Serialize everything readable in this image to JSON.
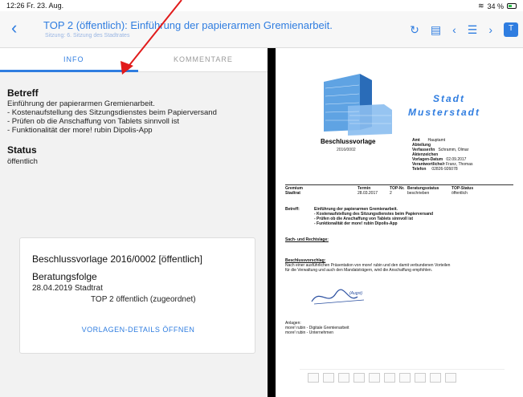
{
  "status_bar": {
    "time": "12:26",
    "date": "Fr. 23. Aug.",
    "battery": "34 %"
  },
  "navbar": {
    "title": "TOP 2 (öffentlich): Einführung der papierarmen Gremienarbeit.",
    "subtitle": "Sitzung: 6. Sitzung des Stadtrates",
    "t_button": "T"
  },
  "tabs": [
    {
      "label": "INFO"
    },
    {
      "label": "KOMMENTARE"
    }
  ],
  "info": {
    "betreff_heading": "Betreff",
    "betreff_lines": [
      "Einführung der papierarmen Gremienarbeit.",
      "- Kostenaufstellung des Sitzungsdienstes beim Papierversand",
      "- Prüfen ob die Anschaffung von Tablets sinnvoll ist",
      "- Funktionalität der more! rubin Dipolis-App"
    ],
    "status_heading": "Status",
    "status_value": "öffentlich"
  },
  "card": {
    "title": "Beschlussvorlage 2016/0002 [öffentlich]",
    "beratungsfolge": "Beratungsfolge",
    "row_date_body": "28.04.2019  Stadtrat",
    "row_top": "TOP 2 öffentlich (zugeordnet)",
    "button": "VORLAGEN-DETAILS ÖFFNEN"
  },
  "document": {
    "stadt": "Stadt",
    "musterstadt": "Musterstadt",
    "doc_type": "Beschlussvorlage",
    "doc_nr": "2016/0002",
    "meta_rows": [
      [
        "Amt",
        "Hauptamt"
      ],
      [
        "Abteilung",
        ""
      ],
      [
        "Verfasser/in",
        "Schramm, Olmar"
      ],
      [
        "Aktenzeichen",
        ""
      ],
      [
        "Vorlagen-Datum",
        "02.09.2017"
      ],
      [
        "Verantwortliche/r",
        "Franz, Thomas"
      ],
      [
        "Telefon",
        "02826-926078"
      ]
    ],
    "gremium_header": [
      "Gremium",
      "Termin",
      "TOP-Nr.",
      "Beratungsstatus",
      "TOP-Status"
    ],
    "gremium_row": [
      "Stadtrat",
      "28.03.2017",
      "2",
      "beschrieben",
      "öffentlich"
    ],
    "betreff_label": "Betreff:",
    "betreff_text": [
      "Einführung der papierarmen Gremienarbeit.",
      "- Kostenaufstellung des Sitzungsdienstes beim Papierversand",
      "- Prüfen ob die Anschaffung von Tablets sinnvoll ist",
      "- Funktionalität der more! rubin Dipolis-App"
    ],
    "sach_label": "Sach- und Rechtslage:",
    "beschluss_label": "Beschlussvorschlag:",
    "beschluss_text": [
      "Nach einer ausführlichen Präsentation von more! rubin und den damit verbundenen Vorteilen",
      "für die Verwaltung und auch den Mandatsträgern, wird die Anschaffung empfohlen."
    ],
    "signature": "(Augst)",
    "anlagen_label": "Anlagen:",
    "anlagen": [
      "more! rubin - Digitale Gremienarbeit",
      "more! rubin - Unternehmen"
    ]
  },
  "colors": {
    "accent": "#2f7de0",
    "arrow": "#e11b1b"
  }
}
